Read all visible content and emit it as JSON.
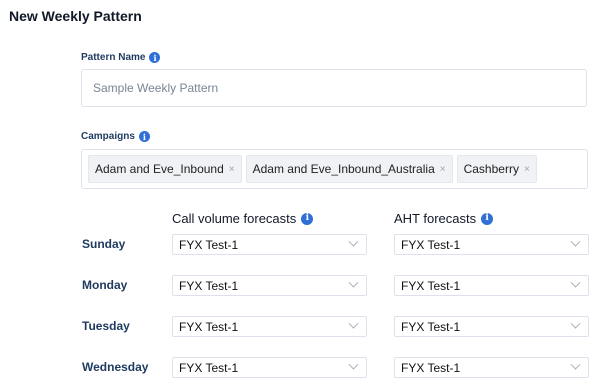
{
  "page": {
    "title": "New Weekly Pattern"
  },
  "pattern_name": {
    "label": "Pattern Name",
    "info_icon": "info-icon",
    "placeholder": "Sample Weekly Pattern"
  },
  "campaigns": {
    "label": "Campaigns",
    "info_icon": "info-icon",
    "tags": [
      "Adam and Eve_Inbound",
      "Adam and Eve_Inbound_Australia",
      "Cashberry"
    ],
    "remove_glyph": "×"
  },
  "forecast_table": {
    "call_volume_header": "Call volume forecasts",
    "aht_header": "AHT forecasts",
    "rows": [
      {
        "day": "Sunday",
        "call_volume": "FYX Test-1",
        "aht": "FYX Test-1"
      },
      {
        "day": "Monday",
        "call_volume": "FYX Test-1",
        "aht": "FYX Test-1"
      },
      {
        "day": "Tuesday",
        "call_volume": "FYX Test-1",
        "aht": "FYX Test-1"
      },
      {
        "day": "Wednesday",
        "call_volume": "FYX Test-1",
        "aht": "FYX Test-1"
      }
    ]
  },
  "colors": {
    "accent": "#2f6fd6",
    "label": "#1e3a5f",
    "border": "#dde2ea"
  }
}
